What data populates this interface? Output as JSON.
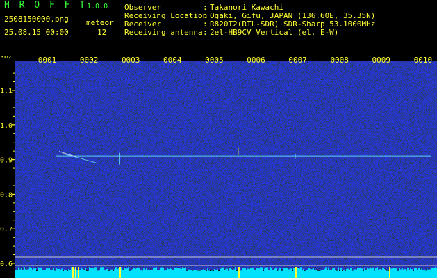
{
  "header": {
    "brand": "H R O F F T",
    "version": "1.0.0",
    "filename": "2508150000.png",
    "datetime": "25.08.15 00:00",
    "meteor_label": "meteor",
    "meteor_count": "12"
  },
  "observer": [
    {
      "key": "Observer",
      "value": "Takanori Kawachi"
    },
    {
      "key": "Receiving Location",
      "value": "Ogaki, Gifu, JAPAN (136.60E, 35.35N)"
    },
    {
      "key": "Receiver",
      "value": "R820T2(RTL-SDR) SDR-Sharp 53.1000MHz"
    },
    {
      "key": "Receiving antenna",
      "value": "2el-HB9CV Vertical (el. E-W)"
    }
  ],
  "plot": {
    "y_unit": "kHz",
    "y_labels": [
      "1.1",
      "1.0",
      "0.9",
      "0.8",
      "0.7",
      "0.6"
    ],
    "y_values": [
      1.1,
      1.0,
      0.9,
      0.8,
      0.7,
      0.6
    ],
    "x_labels": [
      "0001",
      "0002",
      "0003",
      "0004",
      "0005",
      "0006",
      "0007",
      "0008",
      "0009",
      "0010"
    ],
    "carrier_khz": 0.91,
    "colors": {
      "axis": "#ffff33",
      "carrier": "#66ddff",
      "noise": "#1a1aa0",
      "bottom_bar": "#00e0ff",
      "spike": "#ffff33"
    }
  }
}
